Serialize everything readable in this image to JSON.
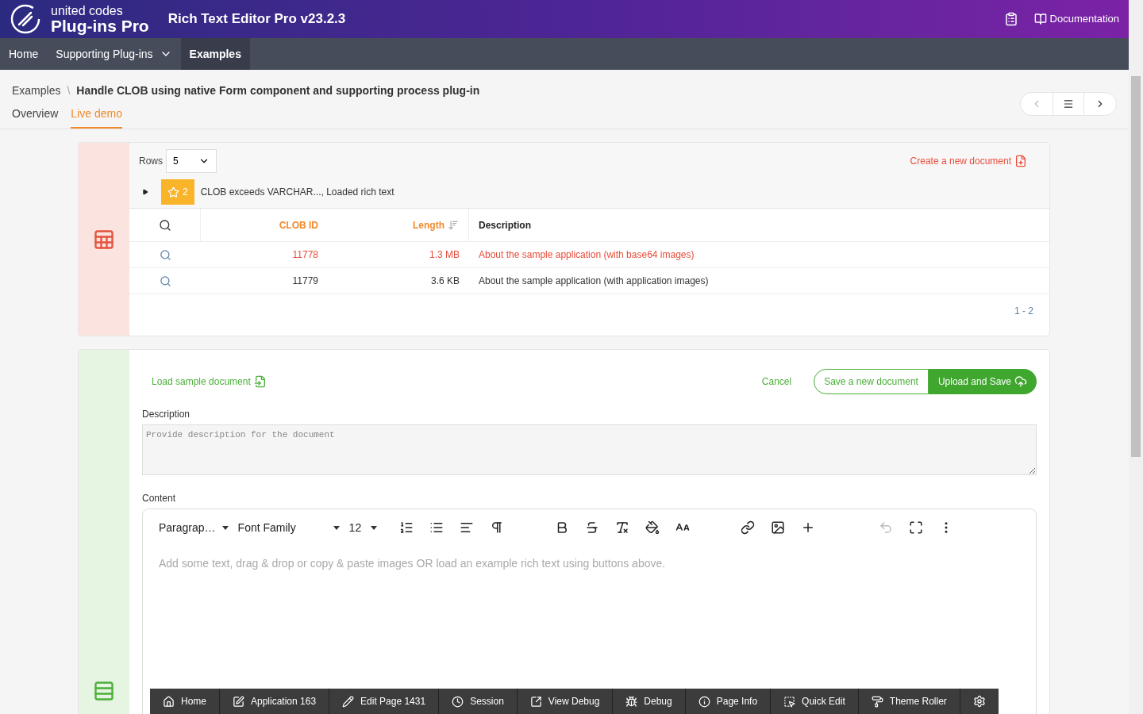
{
  "header": {
    "logo_top": "united codes",
    "logo_bottom": "Plug-ins Pro",
    "app_title": "Rich Text Editor Pro v23.2.3",
    "doc_link": "Documentation"
  },
  "nav": [
    {
      "label": "Home",
      "selected": false,
      "has_menu": false
    },
    {
      "label": "Supporting Plug-ins",
      "selected": false,
      "has_menu": true
    },
    {
      "label": "Examples",
      "selected": true,
      "has_menu": false
    }
  ],
  "breadcrumb": {
    "parent": "Examples",
    "separator": "\\",
    "current": "Handle CLOB using native Form component and supporting process plug-in"
  },
  "tabs": [
    {
      "label": "Overview",
      "selected": false
    },
    {
      "label": "Live demo",
      "selected": true
    }
  ],
  "report": {
    "rows_label": "Rows",
    "rows_value": "5",
    "create_link": "Create a new document",
    "control_break": {
      "expanded": false,
      "count": "2",
      "text": "CLOB exceeds VARCHAR..., Loaded rich text"
    },
    "columns": [
      {
        "label": "CLOB ID",
        "sorted": false
      },
      {
        "label": "Length",
        "sorted": true
      },
      {
        "label": "Description",
        "sorted": false
      }
    ],
    "rows": [
      {
        "clob_id": "11778",
        "length": "1.3 MB",
        "description": "About the sample application (with base64 images)",
        "selected": true
      },
      {
        "clob_id": "11779",
        "length": "3.6 KB",
        "description": "About the sample application (with application images)",
        "selected": false
      }
    ],
    "pagination": "1 - 2"
  },
  "form": {
    "load_link": "Load sample document",
    "cancel": "Cancel",
    "save_new": "Save a new document",
    "upload_save": "Upload and Save",
    "description_label": "Description",
    "description_placeholder": "Provide description for the document",
    "content_label": "Content",
    "block_format": "Paragrap…",
    "font_family": "Font Family",
    "font_size": "12",
    "editor_placeholder": "Add some text, drag & drop or copy & paste images OR load an example rich text using buttons above."
  },
  "dev_toolbar": [
    "Home",
    "Application 163",
    "Edit Page 1431",
    "Session",
    "View Debug",
    "Debug",
    "Page Info",
    "Quick Edit",
    "Theme Roller"
  ]
}
